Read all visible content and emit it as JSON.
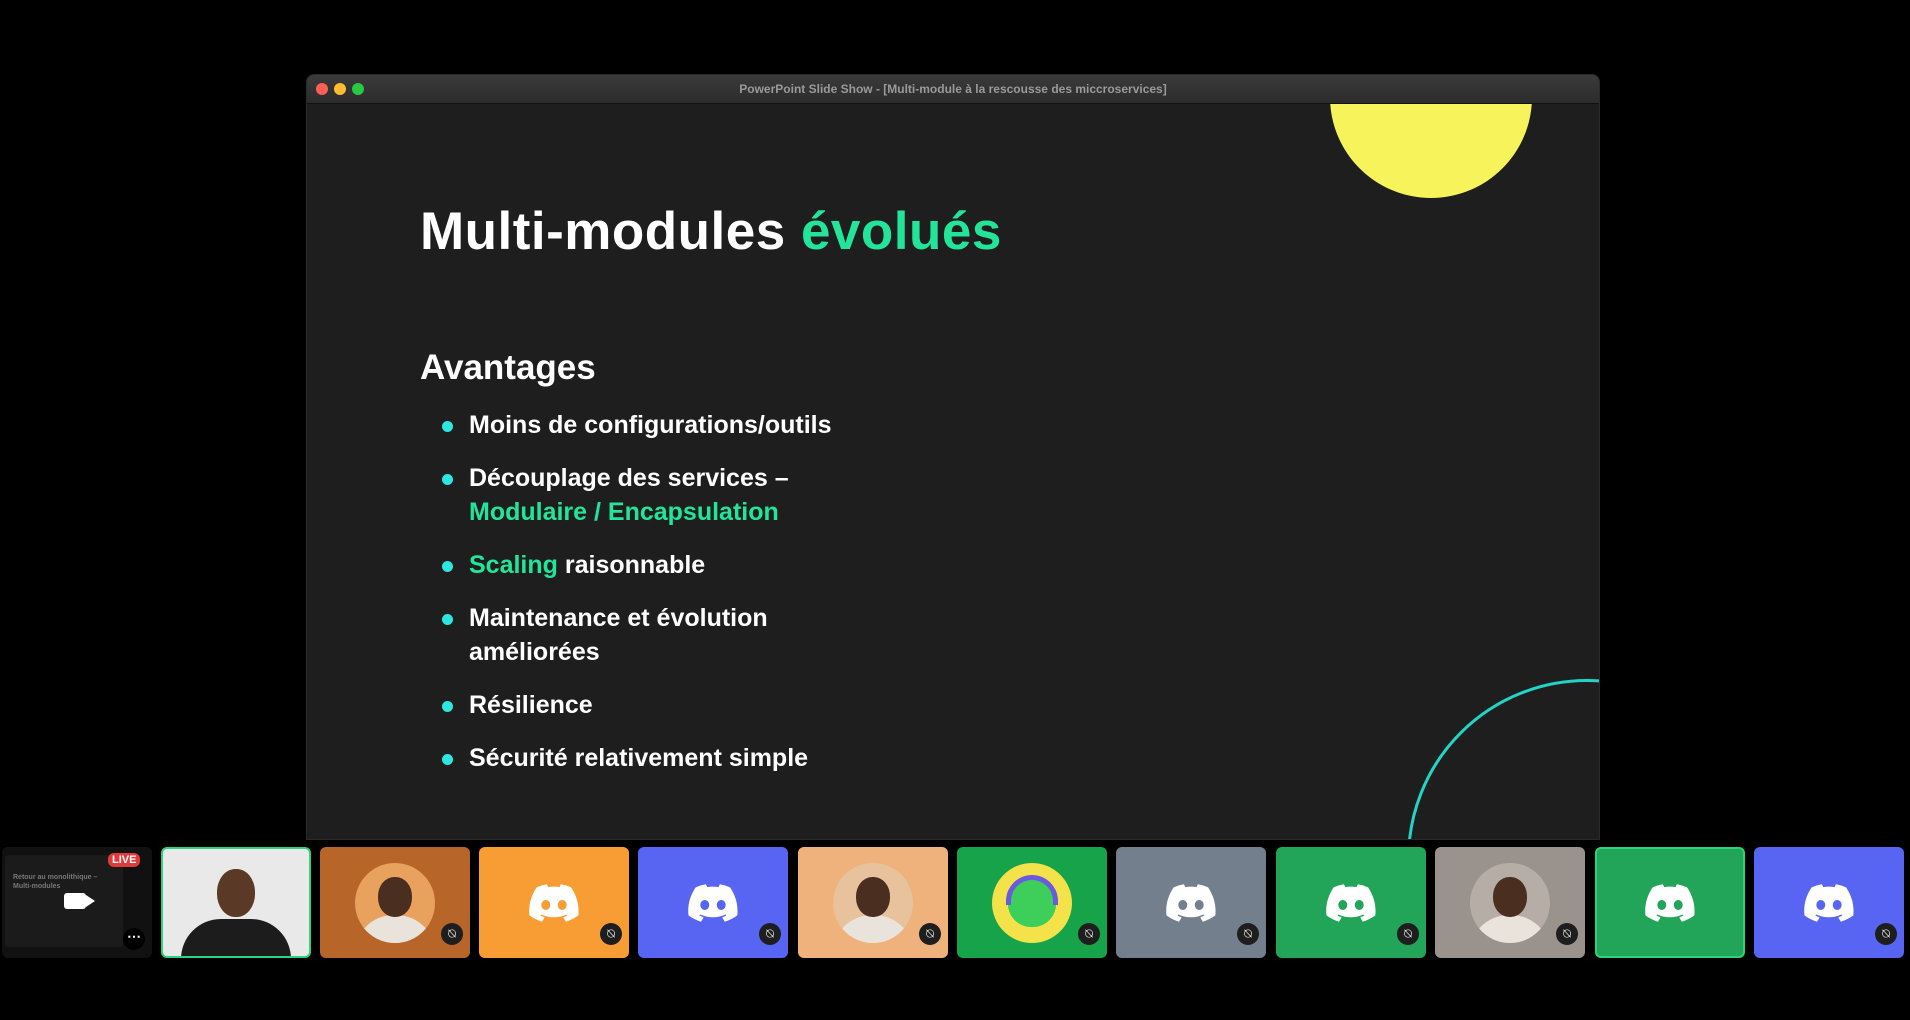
{
  "window": {
    "title": "PowerPoint Slide Show - [Multi-module à la rescousse des miccroservices]"
  },
  "slide": {
    "title_part1": "Multi-modules",
    "title_accent": "évolués",
    "section_heading": "Avantages",
    "bullets": [
      {
        "text": "Moins de configurations/outils"
      },
      {
        "text": "Découplage des services –",
        "accent_line": "Modulaire / Encapsulation"
      },
      {
        "accent": "Scaling",
        "text": " raisonnable"
      },
      {
        "text": "Maintenance et évolution",
        "line2": "améliorées"
      },
      {
        "text": "Résilience"
      },
      {
        "text": "Sécurité relativement simple"
      }
    ]
  },
  "participants": {
    "stream": {
      "preview_title": "Retour au monolithique –",
      "preview_subtitle": "Multi-modules",
      "live_label": "LIVE",
      "more_label": "⋯"
    },
    "tiles": [
      {
        "type": "webcam",
        "speaking": true
      },
      {
        "type": "photo",
        "bg": "#b8652a",
        "ring": "#e9a15e",
        "muted": true
      },
      {
        "type": "discord",
        "bg": "#f89d34",
        "muted": true
      },
      {
        "type": "discord",
        "bg": "#5865f2",
        "muted": true
      },
      {
        "type": "photo",
        "bg": "#f0b27c",
        "ring": "#e8c29d",
        "muted": true
      },
      {
        "type": "mascot",
        "bg": "#16a34a",
        "muted": true
      },
      {
        "type": "discord",
        "bg": "#747f8d",
        "muted": true
      },
      {
        "type": "discord",
        "bg": "#22a559",
        "muted": true
      },
      {
        "type": "photo",
        "bg": "#9a928c",
        "ring": "#b6aea6",
        "muted": true
      },
      {
        "type": "discord",
        "bg": "#22a559",
        "speaking": true,
        "muted": false
      },
      {
        "type": "discord",
        "bg": "#5865f2",
        "muted": true
      }
    ]
  },
  "colors": {
    "title_accent": "#22e59a",
    "bullet_dot": "#2ee6e0",
    "decor_sun": "#f6f45a",
    "decor_ring": "#21d4c4",
    "speaking_border": "#2bd47a"
  }
}
